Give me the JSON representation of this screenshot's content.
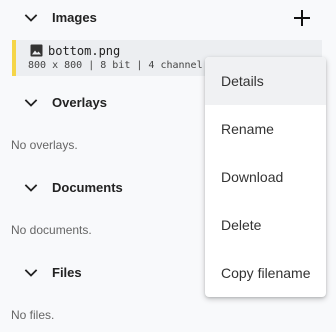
{
  "sections": {
    "images": {
      "title": "Images",
      "items": [
        {
          "name": "bottom.png",
          "meta": "800 x 800 | 8 bit | 4 channel"
        }
      ]
    },
    "overlays": {
      "title": "Overlays",
      "empty": "No overlays."
    },
    "documents": {
      "title": "Documents",
      "empty": "No documents."
    },
    "files": {
      "title": "Files",
      "empty": "No files."
    }
  },
  "icons": {
    "add": "plus-icon",
    "section_toggle": "chevron-down-icon",
    "image": "image-icon"
  },
  "context_menu": {
    "items": [
      {
        "label": "Details",
        "active": true
      },
      {
        "label": "Rename",
        "active": false
      },
      {
        "label": "Download",
        "active": false
      },
      {
        "label": "Delete",
        "active": false
      },
      {
        "label": "Copy filename",
        "active": false
      }
    ]
  },
  "colors": {
    "selected_accent": "#f5d548",
    "selected_background": "#eceef1",
    "menu_hover": "#f0f1f3",
    "background": "#f8f9fb"
  }
}
